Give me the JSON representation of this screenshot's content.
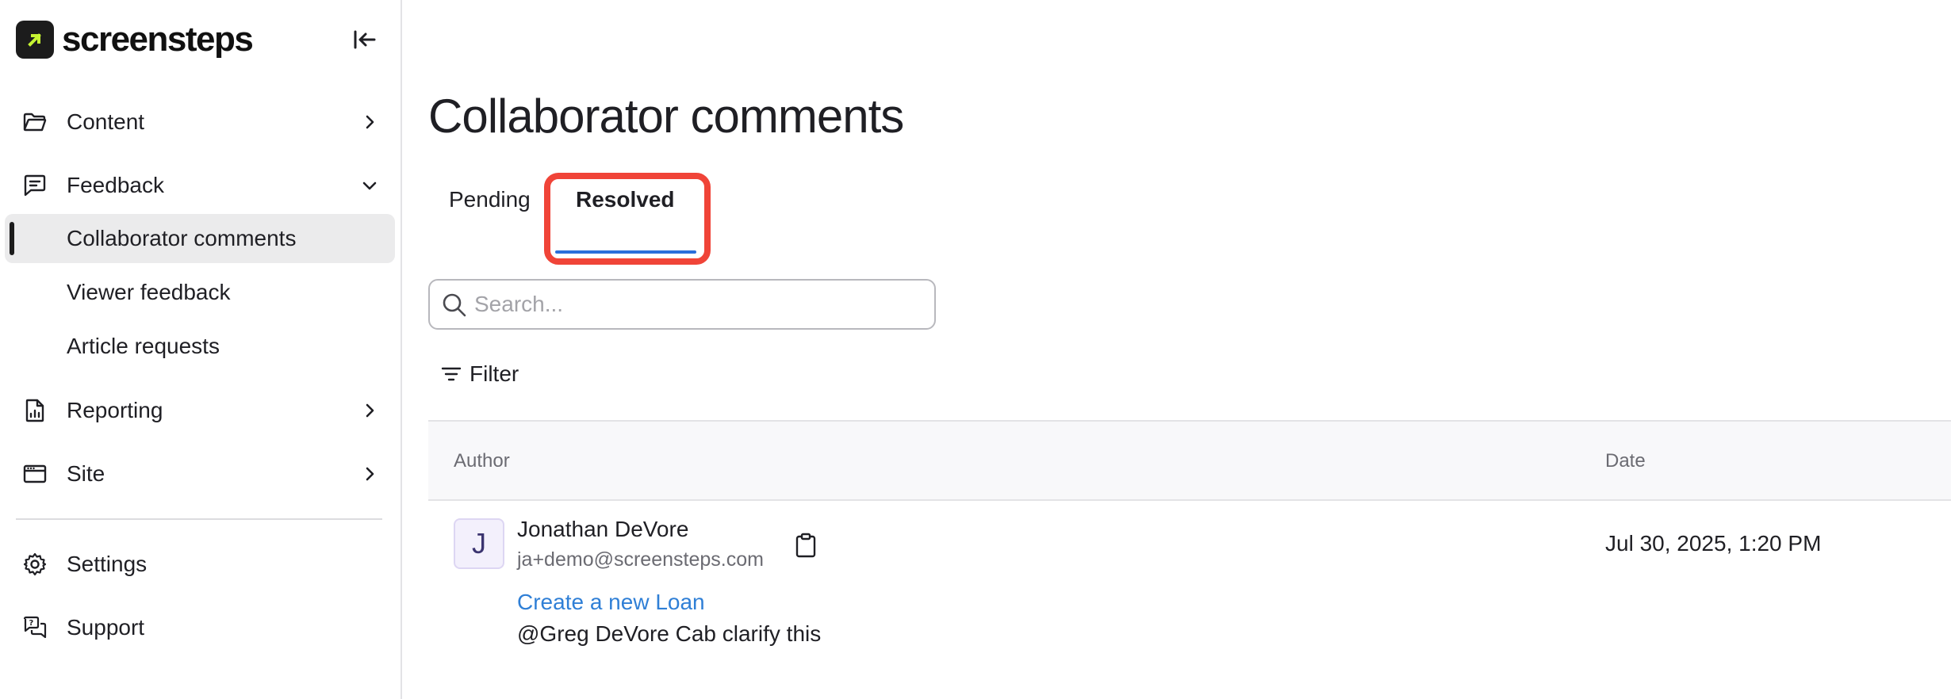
{
  "brand": {
    "name": "screensteps",
    "accent_color": "#c6f432"
  },
  "sidebar": {
    "collapse_icon": "collapse-left-icon",
    "items": [
      {
        "label": "Content",
        "icon": "folder-icon"
      },
      {
        "label": "Feedback",
        "icon": "message-square-icon"
      },
      {
        "label": "Reporting",
        "icon": "report-file-icon"
      },
      {
        "label": "Site",
        "icon": "browser-window-icon"
      },
      {
        "label": "Settings",
        "icon": "gear-icon"
      },
      {
        "label": "Support",
        "icon": "help-chat-icon"
      }
    ],
    "feedback_sub": [
      {
        "label": "Collaborator comments",
        "active": true
      },
      {
        "label": "Viewer feedback",
        "active": false
      },
      {
        "label": "Article requests",
        "active": false
      }
    ]
  },
  "main": {
    "title": "Collaborator comments",
    "tabs": [
      {
        "label": "Pending",
        "selected": false
      },
      {
        "label": "Resolved",
        "selected": true
      }
    ],
    "search": {
      "placeholder": "Search...",
      "value": ""
    },
    "filter_label": "Filter",
    "table": {
      "columns": [
        "Author",
        "Date"
      ],
      "rows": [
        {
          "avatar_letter": "J",
          "author_name": "Jonathan DeVore",
          "author_email": "ja+demo@screensteps.com",
          "date": "Jul 30, 2025, 1:20 PM",
          "article": "Create a new Loan",
          "comment": "@Greg DeVore Cab clarify this"
        }
      ]
    }
  },
  "colors": {
    "tab_underline": "#2a6fdb",
    "highlight_box": "#f04438",
    "link": "#2f7fd6"
  }
}
